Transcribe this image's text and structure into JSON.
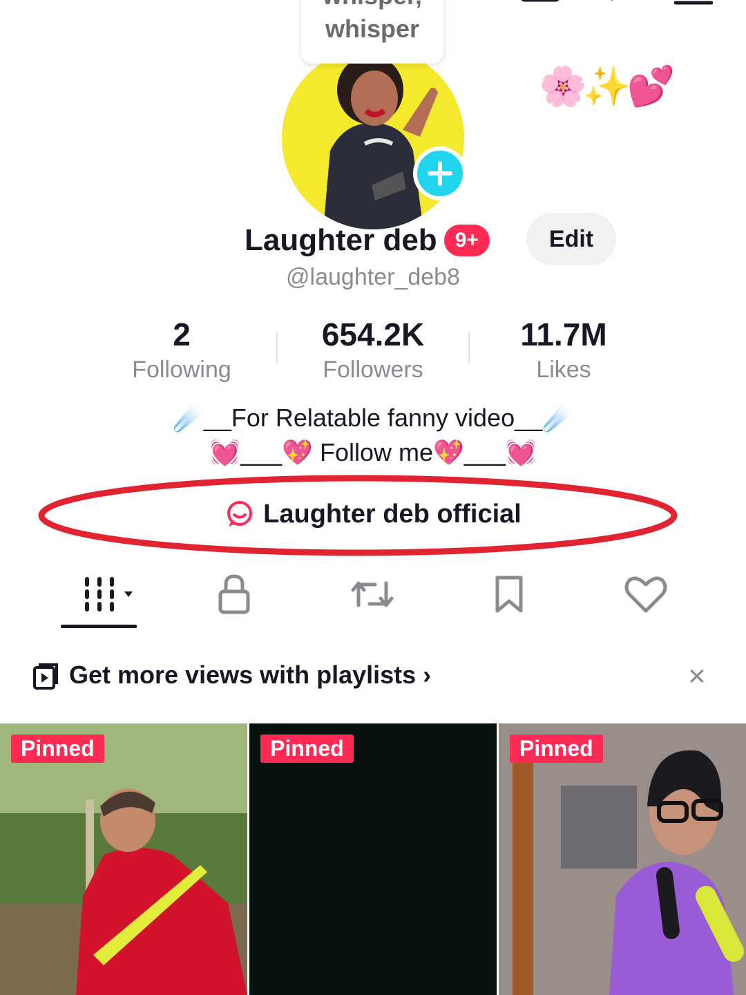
{
  "tooltip": {
    "line1": "whisper,",
    "line2": "whisper"
  },
  "decor_emojis": "🌸✨💕",
  "profile": {
    "name": "Laughter deb",
    "badge": "9+",
    "edit_label": "Edit",
    "handle": "@laughter_deb8"
  },
  "stats": [
    {
      "value": "2",
      "label": "Following"
    },
    {
      "value": "654.2K",
      "label": "Followers"
    },
    {
      "value": "11.7M",
      "label": "Likes"
    }
  ],
  "bio": {
    "line1": "☄️__For Relatable fanny video__☄️",
    "line2": "💓___💖 Follow me💖___💓"
  },
  "link": {
    "label": "Laughter deb official",
    "highlight_color": "#e02431"
  },
  "tabs": [
    "videos-grid",
    "private",
    "reposts",
    "favorites",
    "liked"
  ],
  "banner": {
    "text": "Get more views with playlists ›",
    "close": "×"
  },
  "videos": [
    {
      "pinned_label": "Pinned"
    },
    {
      "pinned_label": "Pinned"
    },
    {
      "pinned_label": "Pinned"
    }
  ],
  "colors": {
    "accent": "#fe2c55",
    "follow": "#20d5ec",
    "avatar_bg": "#f5e92d"
  }
}
